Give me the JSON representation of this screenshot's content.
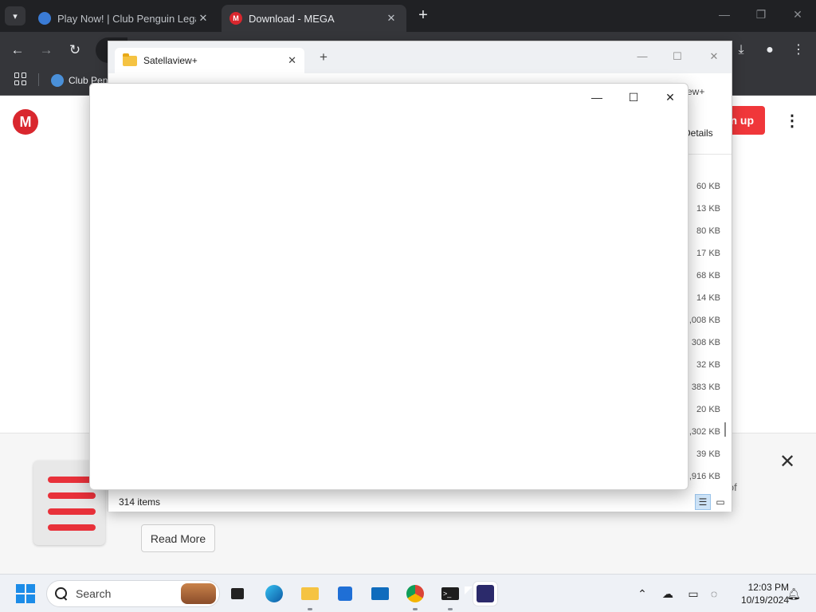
{
  "chrome": {
    "tabs": [
      {
        "title": "Play Now! | Club Penguin Legac",
        "favicon": "club-penguin-icon"
      },
      {
        "title": "Download - MEGA",
        "favicon": "mega-icon"
      }
    ],
    "new_tab_label": "+",
    "bookmark": {
      "label": "Club Peng",
      "favicon": "club-penguin-icon"
    },
    "colors": {
      "frame": "#202124",
      "toolbar": "#35363a"
    }
  },
  "mega": {
    "logo_letter": "M",
    "signup_label": "n up",
    "promo_text_fragment": "e of",
    "read_more_label": "Read More",
    "colors": {
      "brand": "#d9272e",
      "signup": "#f0373a"
    }
  },
  "explorer": {
    "tab_title": "Satellaview+",
    "breadcrumb_fragment": "ew+",
    "details_label": "Details",
    "sizes": [
      "60 KB",
      "13 KB",
      "80 KB",
      "17 KB",
      "68 KB",
      "14 KB",
      ",008 KB",
      "308 KB",
      "32 KB",
      "383 KB",
      "20 KB",
      ",302 KB",
      "39 KB",
      ",916 KB"
    ],
    "item_count": "314 items"
  },
  "taskbar": {
    "search_placeholder": "Search",
    "time": "12:03 PM",
    "date": "10/19/2024",
    "apps": [
      "task-view-icon",
      "edge-icon",
      "file-explorer-icon",
      "store-icon",
      "mail-icon",
      "chrome-icon",
      "terminal-icon",
      "emulator-icon"
    ]
  }
}
